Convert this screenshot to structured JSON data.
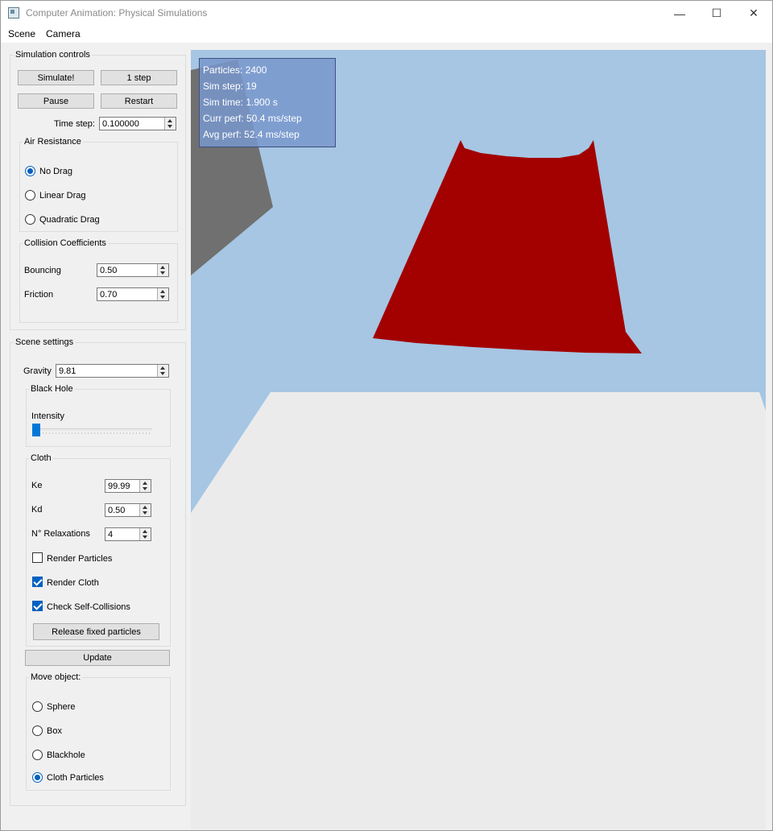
{
  "window": {
    "title": "Computer Animation: Physical Simulations",
    "controls": {
      "minimize": "—",
      "maximize": "☐",
      "close": "✕"
    }
  },
  "menu": {
    "scene": "Scene",
    "camera": "Camera"
  },
  "sim_controls": {
    "title": "Simulation controls",
    "simulate": "Simulate!",
    "one_step": "1 step",
    "pause": "Pause",
    "restart": "Restart",
    "time_step_label": "Time step:",
    "time_step_value": "0.100000"
  },
  "air_resistance": {
    "title": "Air Resistance",
    "options": [
      "No Drag",
      "Linear Drag",
      "Quadratic Drag"
    ],
    "selected": "No Drag"
  },
  "collision": {
    "title": "Collision Coefficients",
    "bouncing_label": "Bouncing",
    "bouncing_value": "0.50",
    "friction_label": "Friction",
    "friction_value": "0.70"
  },
  "scene_settings": {
    "title": "Scene settings",
    "gravity_label": "Gravity",
    "gravity_value": "9.81",
    "black_hole": {
      "title": "Black Hole",
      "intensity_label": "Intensity",
      "intensity_level": 0
    },
    "cloth": {
      "title": "Cloth",
      "ke_label": "Ke",
      "ke_value": "99.99",
      "kd_label": "Kd",
      "kd_value": "0.50",
      "relax_label": "N° Relaxations",
      "relax_value": "4",
      "render_particles": "Render Particles",
      "render_particles_checked": false,
      "render_cloth": "Render Cloth",
      "render_cloth_checked": true,
      "self_collisions": "Check Self-Collisions",
      "self_collisions_checked": true,
      "release": "Release fixed particles"
    },
    "update": "Update",
    "move_object": {
      "title": "Move object:",
      "options": [
        "Sphere",
        "Box",
        "Blackhole",
        "Cloth Particles"
      ],
      "selected": "Cloth Particles"
    }
  },
  "stats": {
    "particles": "Particles: 2400",
    "sim_step": "Sim step:  19",
    "sim_time": "Sim time:  1.900 s",
    "curr_perf": "Curr perf: 50.4 ms/step",
    "avg_perf": "Avg perf:  52.4 ms/step"
  },
  "colors": {
    "sky": "#a6c6e3",
    "cloth": "#a30000",
    "floor": "#ebebeb",
    "box": "#707070",
    "accent": "#0078d7"
  }
}
